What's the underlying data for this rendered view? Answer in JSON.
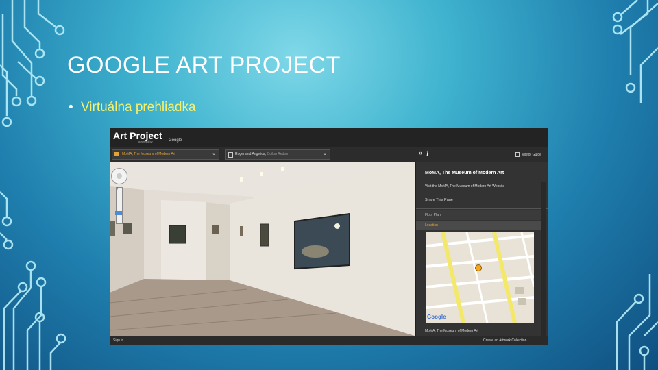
{
  "slide": {
    "title": "GOOGLE ART PROJECT",
    "bullet_dot": "•",
    "bullet_link": "Virtuálna prehliadka"
  },
  "screenshot": {
    "app_title": "Art Project",
    "logo_powered": "powered by",
    "logo_google": "Google",
    "museum_select": "MoMA, The Museum of Modern Art",
    "artwork_select": "Roger and Angelica,",
    "artwork_select_artist": "Odilon Redon",
    "panel_toggle": "»",
    "info_icon": "i",
    "visitor_guide": "Visitor Guide",
    "sidebar": {
      "museum_name": "MoMA, The Museum of Modern Art",
      "website_link": "Visit the MoMA, The Museum of Modern Art Website",
      "share": "Share This Page",
      "floor_plan": "Floor Plan",
      "location": "Location",
      "address": "MoMA, The Museum of Modern Art"
    },
    "footer": {
      "sign_in": "Sign in",
      "create_collection": "Create an Artwork Collection"
    },
    "map_logo": "Google"
  },
  "colors": {
    "accent_orange": "#e0a33a",
    "link_yellow": "#f6f06b"
  }
}
